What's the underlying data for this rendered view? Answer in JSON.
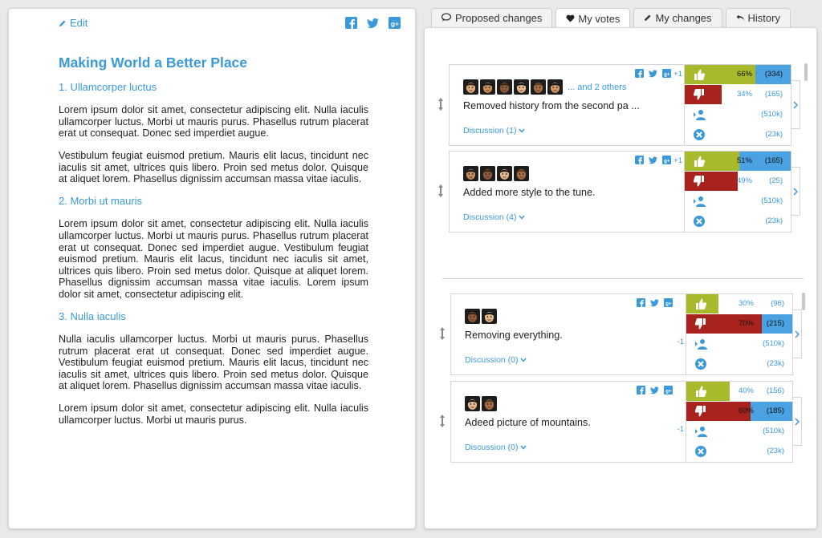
{
  "document": {
    "edit_label": "Edit",
    "title": "Making World a Better Place",
    "sections": [
      {
        "heading": "1. Ullamcorper luctus",
        "paragraphs": [
          "Lorem ipsum dolor sit amet, consectetur adipiscing elit. Nulla iaculis ullamcorper luctus. Morbi ut mauris purus. Phasellus rutrum placerat erat ut consequat. Donec sed imperdiet augue.",
          "Vestibulum feugiat euismod pretium. Mauris elit lacus, tincidunt nec iaculis sit amet, ultrices quis libero. Proin sed metus dolor. Quisque at aliquet lorem. Phasellus dignissim accumsan massa vitae iaculis."
        ]
      },
      {
        "heading": "2. Morbi ut mauris",
        "paragraphs": [
          "Lorem ipsum dolor sit amet, consectetur adipiscing elit. Nulla iaculis ullamcorper luctus. Morbi ut mauris purus. Phasellus rutrum placerat erat ut consequat. Donec sed imperdiet augue. Vestibulum feugiat euismod pretium. Mauris elit lacus, tincidunt nec iaculis sit amet, ultrices quis libero. Proin sed metus dolor. Quisque at aliquet lorem. Phasellus dignissim accumsan massa vitae iaculis. Lorem ipsum dolor sit amet, consectetur adipiscing elit."
        ]
      },
      {
        "heading": "3. Nulla iaculis",
        "paragraphs": [
          "Nulla iaculis ullamcorper luctus. Morbi ut mauris purus. Phasellus rutrum placerat erat ut consequat. Donec sed imperdiet augue. Vestibulum feugiat euismod pretium. Mauris elit lacus, tincidunt nec iaculis sit amet, ultrices quis libero. Proin sed metus dolor. Quisque at aliquet lorem. Phasellus dignissim accumsan massa vitae iaculis.",
          "Lorem ipsum dolor sit amet, consectetur adipiscing elit. Nulla iaculis ullamcorper luctus. Morbi ut mauris purus."
        ]
      }
    ]
  },
  "tabs": [
    {
      "label": "Proposed changes",
      "icon": "comments-icon"
    },
    {
      "label": "My votes",
      "icon": "heart-icon",
      "active": true
    },
    {
      "label": "My changes",
      "icon": "pencil-icon"
    },
    {
      "label": "History",
      "icon": "undo-icon"
    }
  ],
  "colors": {
    "accent": "#3a9ad9",
    "up": "#a9b92c",
    "down": "#a9231e",
    "abstain_bar": "#4aa2e3"
  },
  "cards": [
    {
      "avatars": 6,
      "others": "... and 2 others",
      "text": "Removed history from the second pa ...",
      "discussion": "Discussion (1)",
      "my_vote": "+1",
      "up": {
        "pct": "66%",
        "count": "(334)",
        "share": 0.66
      },
      "down": {
        "pct": "34%",
        "count": "(165)",
        "share": 0.34
      },
      "users": {
        "count": "(510k)"
      },
      "cancel": {
        "count": "(23k)"
      }
    },
    {
      "avatars": 4,
      "others": "",
      "text": "Added more style to the tune.",
      "discussion": "Discussion (4)",
      "my_vote": "+1",
      "up": {
        "pct": "51%",
        "count": "(165)",
        "share": 0.51
      },
      "down": {
        "pct": "49%",
        "count": "(25)",
        "share": 0.49
      },
      "users": {
        "count": "(510k)"
      },
      "cancel": {
        "count": "(23k)"
      }
    },
    {
      "avatars": 2,
      "others": "",
      "text": "Removing everything.",
      "discussion": "Discussion (0)",
      "my_vote": "-1",
      "up": {
        "pct": "30%",
        "count": "(96)",
        "share": 0.3
      },
      "down": {
        "pct": "70%",
        "count": "(215)",
        "share": 0.7
      },
      "users": {
        "count": "(510k)"
      },
      "cancel": {
        "count": "(23k)"
      }
    },
    {
      "avatars": 2,
      "others": "",
      "text": "Adeed picture of mountains.",
      "discussion": "Discussion (0)",
      "my_vote": "-1",
      "up": {
        "pct": "40%",
        "count": "(156)",
        "share": 0.4
      },
      "down": {
        "pct": "60%",
        "count": "(185)",
        "share": 0.6
      },
      "users": {
        "count": "(510k)"
      },
      "cancel": {
        "count": "(23k)"
      }
    }
  ]
}
